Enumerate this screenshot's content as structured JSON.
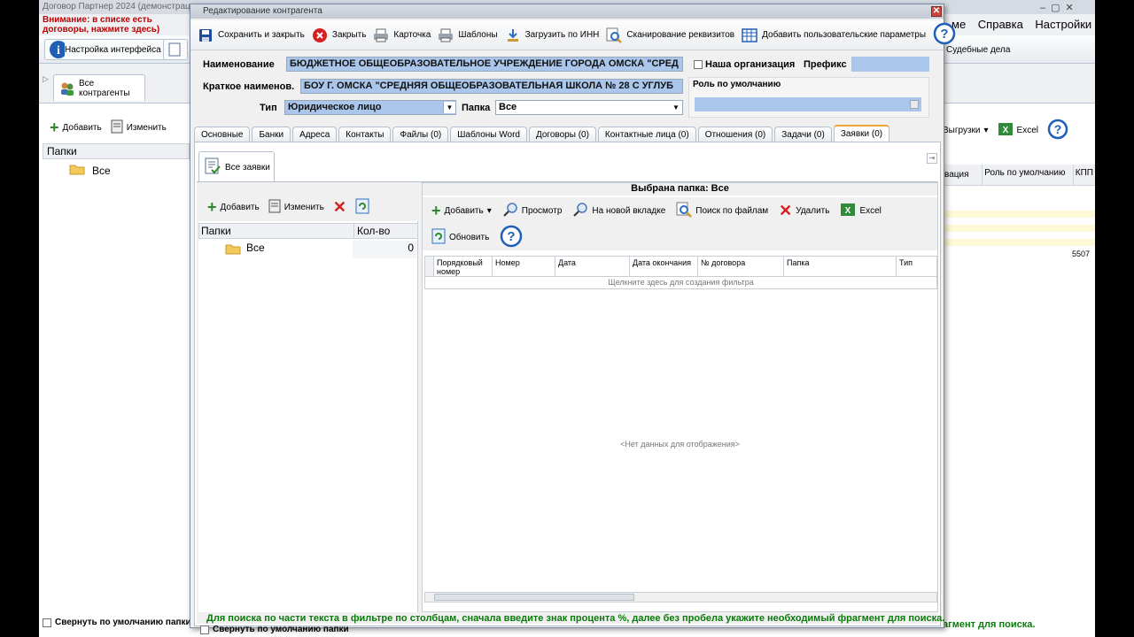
{
  "background_app": {
    "title": "Договор Партнер 2024 (демонстрац",
    "warning": "Внимание: в списке есть договоры, нажмите здесь)",
    "menu": [
      "ме",
      "Справка",
      "Настройки"
    ],
    "ribbon_buttons": [
      "Настройка интерфейса",
      "Судебные дела"
    ],
    "tab_label": "Все контрагенты",
    "toolbar": {
      "add": "Добавить",
      "edit": "Изменить",
      "exports": "Выгрузки",
      "excel": "Excel"
    },
    "folders_header": "Папки",
    "folder_all": "Все",
    "collapse_label": "Свернуть по умолчанию папки",
    "grid_headers": [
      "вация",
      "Роль по умолчанию",
      "КПП"
    ],
    "kpp_value": "5507",
    "status_tail": "агмент для поиска."
  },
  "dialog": {
    "title": "Редактирование контрагента",
    "toolbar": {
      "save_close": "Сохранить и закрыть",
      "close": "Закрыть",
      "card": "Карточка",
      "templates": "Шаблоны",
      "load_inn": "Загрузить по ИНН",
      "scan": "Сканирование реквизитов",
      "add_params": "Добавить пользовательские параметры"
    },
    "form": {
      "name_label": "Наименование",
      "name_value": "БЮДЖЕТНОЕ ОБЩЕОБРАЗОВАТЕЛЬНОЕ УЧРЕЖДЕНИЕ ГОРОДА ОМСКА \"СРЕД",
      "our_org_label": "Наша организация",
      "prefix_label": "Префикс",
      "short_label": "Краткое наименов.",
      "short_value": "БОУ Г. ОМСКА \"СРЕДНЯЯ ОБЩЕОБРАЗОВАТЕЛЬНАЯ ШКОЛА № 28 С УГЛУБ",
      "default_role_label": "Роль по умолчанию",
      "type_label": "Тип",
      "type_value": "Юридическое лицо",
      "folder_label": "Папка",
      "folder_value": "Все"
    },
    "tabs": [
      "Основные",
      "Банки",
      "Адреса",
      "Контакты",
      "Файлы (0)",
      "Шаблоны Word",
      "Договоры (0)",
      "Контактные лица (0)",
      "Отношения (0)",
      "Задачи (0)",
      "Заявки (0)"
    ],
    "active_tab": "Заявки (0)",
    "subtab": "Все заявки",
    "folder_pane": {
      "add": "Добавить",
      "edit": "Изменить",
      "col_folders": "Папки",
      "col_count": "Кол-во",
      "row_name": "Все",
      "row_count": "0",
      "collapse_label": "Свернуть по умолчанию папки"
    },
    "doc_pane": {
      "selected": "Выбрана папка: Все",
      "add": "Добавить",
      "view": "Просмотр",
      "new_tab": "На новой вкладке",
      "search_files": "Поиск по файлам",
      "delete": "Удалить",
      "excel": "Excel",
      "refresh": "Обновить",
      "columns": [
        "Порядковый номер",
        "Номер",
        "Дата",
        "Дата окончания",
        "№ договора",
        "Папка",
        "Тип"
      ],
      "filter_hint": "Щелкните здесь для создания фильтра",
      "empty": "<Нет данных для отображения>"
    },
    "status": "Для поиска по части текста в фильтре по столбцам, сначала введите знак процента %, далее без пробела укажите необходимый фрагмент для поиска."
  },
  "colors": {
    "accent_blue": "#1f5fb5",
    "delete_red": "#d62020",
    "status_green": "#0a7a0a",
    "selection": "#aac6ea"
  }
}
